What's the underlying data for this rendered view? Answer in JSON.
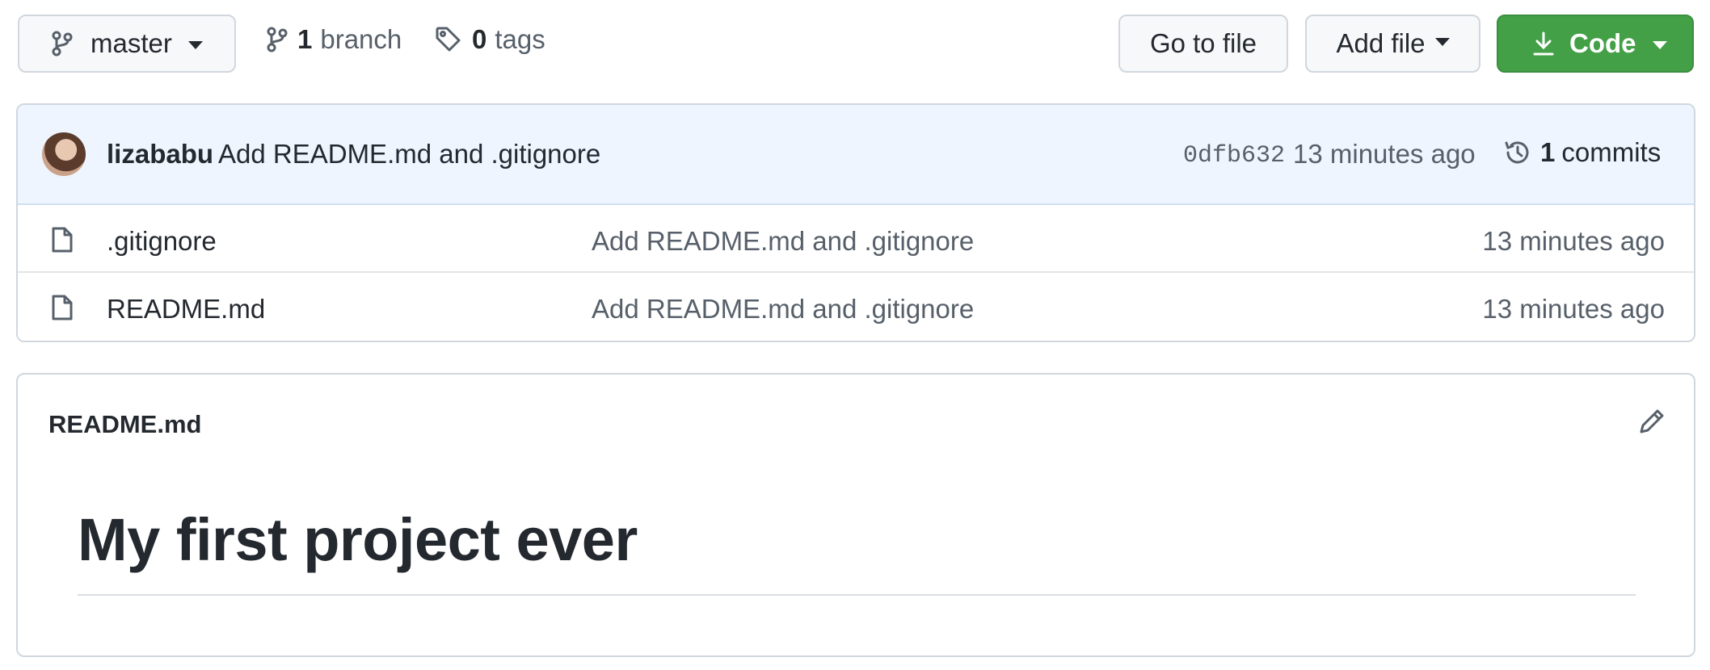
{
  "toolbar": {
    "branch_selector": {
      "label": "master",
      "icon": "git-branch-icon"
    },
    "branches": {
      "count": "1",
      "label": "branch",
      "icon": "git-branch-icon"
    },
    "tags": {
      "count": "0",
      "label": "tags",
      "icon": "tag-icon"
    },
    "go_to_file_label": "Go to file",
    "add_file_label": "Add file",
    "code": {
      "label": "Code",
      "icon": "download-icon"
    }
  },
  "latest_commit": {
    "author": "lizababu",
    "message": "Add README.md and .gitignore",
    "sha": "0dfb632",
    "time": "13 minutes ago",
    "history": {
      "count": "1",
      "label": "commits",
      "icon": "history-icon"
    }
  },
  "files": [
    {
      "name": ".gitignore",
      "message": "Add README.md and .gitignore",
      "time": "13 minutes ago",
      "icon": "file-icon"
    },
    {
      "name": "README.md",
      "message": "Add README.md and .gitignore",
      "time": "13 minutes ago",
      "icon": "file-icon"
    }
  ],
  "readme": {
    "filename": "README.md",
    "heading": "My first project ever",
    "edit_icon": "pencil-icon"
  },
  "colors": {
    "primary_button": "#43a047",
    "commit_bar_bg": "#eef5ff",
    "muted_text": "#57606a",
    "border": "#d0d7de"
  }
}
